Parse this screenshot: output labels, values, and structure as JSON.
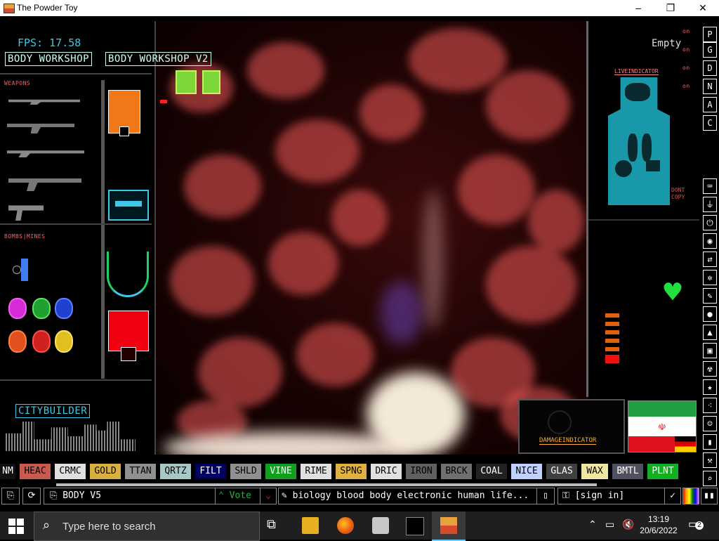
{
  "window": {
    "title": "The Powder Toy",
    "minimize": "–",
    "maximize": "❐",
    "close": "✕"
  },
  "hud": {
    "fps": "FPS: 17.58",
    "body_workshop": "BODY WORKSHOP",
    "body_workshop_v2": "BODY WORKSHOP V2",
    "weapons_label": "WEAPONS",
    "bombs_label": "BOMBS|MINES",
    "citybuilder": "CITYBUILDER",
    "empty": "Empty",
    "on_labels": [
      "on",
      "on",
      "on",
      "on"
    ],
    "live_indicator": "LIVEINDICATOR",
    "dont_copy": "DONT COPY",
    "damage_indicator": "DAMAGEINDICATOR"
  },
  "right_menu": {
    "letters": [
      "P",
      "G",
      "D",
      "N",
      "A",
      "C"
    ],
    "icons": [
      "keyboard-icon",
      "plug-icon",
      "power-icon",
      "sensor-icon",
      "arrows-icon",
      "spray-icon",
      "pen-icon",
      "drop-icon",
      "flask-icon",
      "square-icon",
      "radiation-icon",
      "star-icon",
      "dots-icon",
      "person-icon",
      "bookmark-icon",
      "tools-icon",
      "search-icon"
    ]
  },
  "elements": [
    {
      "label": "NM",
      "bg": "#111111",
      "fg": "#ffffff"
    },
    {
      "label": "HEAC",
      "bg": "#c85a50",
      "fg": "#000000"
    },
    {
      "label": "CRMC",
      "bg": "#e0e0e0",
      "fg": "#000000"
    },
    {
      "label": "GOLD",
      "bg": "#d8b040",
      "fg": "#000000"
    },
    {
      "label": "TTAN",
      "bg": "#909090",
      "fg": "#000000"
    },
    {
      "label": "QRTZ",
      "bg": "#a8c8c8",
      "fg": "#000000"
    },
    {
      "label": "FILT",
      "bg": "#000060",
      "fg": "#ffffff"
    },
    {
      "label": "SHLD",
      "bg": "#909090",
      "fg": "#000000"
    },
    {
      "label": "VINE",
      "bg": "#10a020",
      "fg": "#ffffff"
    },
    {
      "label": "RIME",
      "bg": "#e0e0e0",
      "fg": "#000000"
    },
    {
      "label": "SPNG",
      "bg": "#e0b040",
      "fg": "#000000"
    },
    {
      "label": "DRIC",
      "bg": "#e0e0e0",
      "fg": "#000000"
    },
    {
      "label": "IRON",
      "bg": "#606060",
      "fg": "#000000"
    },
    {
      "label": "BRCK",
      "bg": "#707070",
      "fg": "#000000"
    },
    {
      "label": "COAL",
      "bg": "#222222",
      "fg": "#ffffff"
    },
    {
      "label": "NICE",
      "bg": "#c0d0ff",
      "fg": "#000000"
    },
    {
      "label": "GLAS",
      "bg": "#404040",
      "fg": "#ffffff"
    },
    {
      "label": "WAX",
      "bg": "#f0e8a0",
      "fg": "#000000"
    },
    {
      "label": "BMTL",
      "bg": "#505060",
      "fg": "#ffffff"
    },
    {
      "label": "PLNT",
      "bg": "#10b020",
      "fg": "#ffffff"
    }
  ],
  "bottom_bar": {
    "save_name": "BODY V5",
    "vote": "Vote",
    "tags": "biology blood body electronic human life...",
    "sign_in": "[sign in]"
  },
  "taskbar": {
    "search_placeholder": "Type here to search",
    "time": "13:19",
    "date": "20/6/2022",
    "notification_count": "2"
  },
  "colors": {
    "hud_cyan": "#3ec8e8",
    "sim_red": "#f06060",
    "accent_green": "#20e040"
  }
}
